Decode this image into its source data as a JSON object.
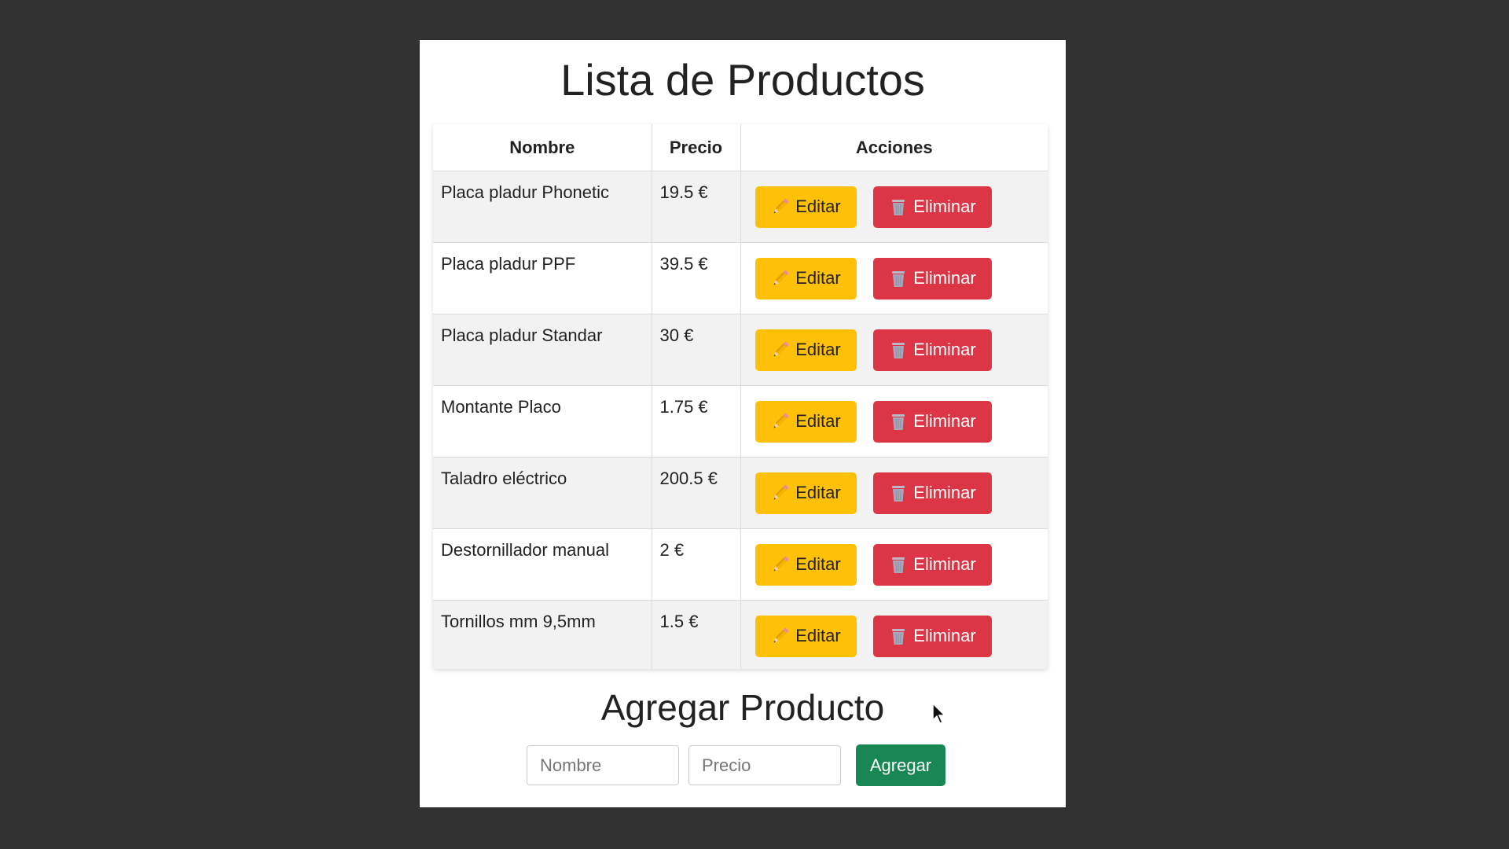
{
  "page": {
    "title": "Lista de Productos",
    "background_color": "#323232"
  },
  "table": {
    "headers": [
      "Nombre",
      "Precio",
      "Acciones"
    ],
    "edit_label": "Editar",
    "delete_label": "Eliminar",
    "edit_icon": "pencil-icon",
    "delete_icon": "trash-icon",
    "rows": [
      {
        "nombre": "Placa pladur Phonetic",
        "precio": "19.5 €"
      },
      {
        "nombre": "Placa pladur PPF",
        "precio": "39.5 €"
      },
      {
        "nombre": "Placa pladur Standar",
        "precio": "30 €"
      },
      {
        "nombre": "Montante Placo",
        "precio": "1.75 €"
      },
      {
        "nombre": "Taladro eléctrico",
        "precio": "200.5 €"
      },
      {
        "nombre": "Destornillador manual",
        "precio": "2 €"
      },
      {
        "nombre": "Tornillos mm 9,5mm",
        "precio": "1.5 €"
      }
    ]
  },
  "add_form": {
    "title": "Agregar Producto",
    "name_placeholder": "Nombre",
    "name_value": "",
    "price_placeholder": "Precio",
    "price_value": "",
    "submit_label": "Agregar"
  },
  "colors": {
    "edit": "#ffc107",
    "delete": "#dc3545",
    "add": "#198754"
  }
}
